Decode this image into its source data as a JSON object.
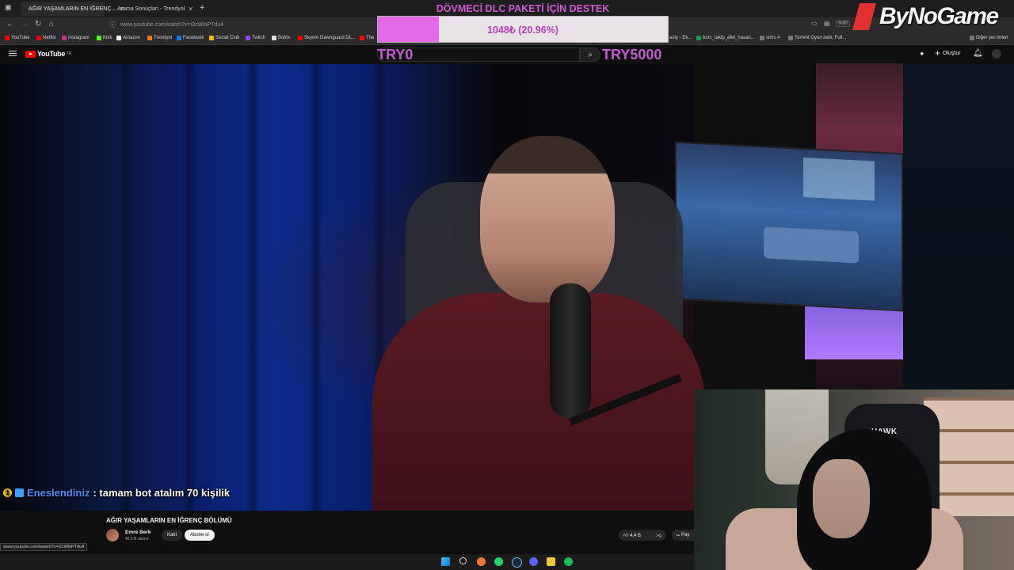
{
  "browser": {
    "tabs": [
      {
        "label": "AĞIR YAŞAMLARIN EN İĞRENÇ...",
        "active": true
      },
      {
        "label": "Arama Sonuçları - Trendyol",
        "active": false
      }
    ],
    "url": "www.youtube.com/watch?v=i2cWloPTdu4",
    "zoom": "%90",
    "bookmarks": [
      "YouTube",
      "Netflix",
      "Instagram",
      "Kick",
      "Amazon",
      "Trendyol",
      "Facebook",
      "Social Club",
      "Twitch",
      "Botrix",
      "Skyrim Dawnguard DL...",
      "The",
      "asty - Ek...",
      "borc_takip_afet_hasan...",
      "sims 4",
      "Torrent Oyun indir, Full...",
      "Diğer yer imleri"
    ],
    "status_url": "www.youtube.com/watch?v=i2cWloPTdu4"
  },
  "youtube": {
    "logo": "YouTube",
    "region": "TR",
    "create_label": "Oluştur"
  },
  "overlay": {
    "donate_title": "DÖVMECİ DLC PAKETİ İÇİN DESTEK",
    "progress_text": "1048₺ (20.96%)",
    "progress_fraction": 0.2096,
    "goal_min": "TRY0",
    "goal_max": "TRY5000",
    "fill_color": "#e369e6"
  },
  "logo": {
    "text": "ByNoGame"
  },
  "chat": {
    "username": "Eneslendiniz",
    "message": ": tamam bot atalım 70 kişilik"
  },
  "video": {
    "title": "AĞIR YAŞAMLARIN EN İĞRENÇ BÖLÜMÜ",
    "channel": "Emre Berk",
    "subscribers": "46,5 B abone",
    "join_label": "Katıl",
    "subscribe_label": "Abone ol",
    "likes": "4,4 B",
    "share_label": "Pay"
  },
  "webcam": {
    "chair_brand": "HAWK"
  }
}
